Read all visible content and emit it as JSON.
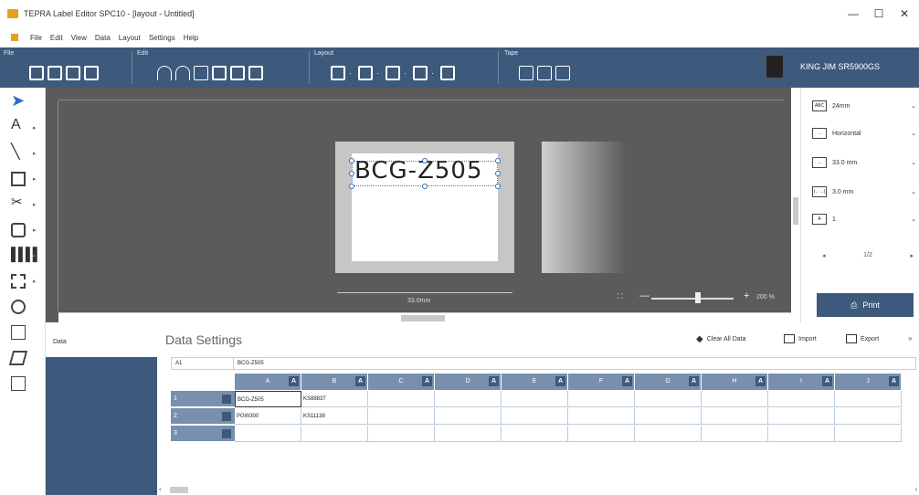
{
  "window": {
    "title": "TEPRA Label Editor SPC10 - [layout - Untitled]",
    "minimize": "—",
    "maximize": "☐",
    "close": "✕"
  },
  "menu": [
    "File",
    "Edit",
    "View",
    "Data",
    "Layout",
    "Settings",
    "Help"
  ],
  "ribbon": {
    "groups": [
      {
        "label": "File",
        "icons": [
          "new-icon",
          "open-icon",
          "save-icon",
          "book-icon"
        ]
      },
      {
        "label": "Edit",
        "icons": [
          "undo-icon",
          "redo-icon",
          "cut-icon",
          "copy-icon",
          "paste-icon",
          "delete-icon"
        ]
      },
      {
        "label": "Layout",
        "icons": [
          "align-icon",
          "distribute-icon",
          "rotate-icon",
          "group-icon",
          "arrange-icon"
        ]
      },
      {
        "label": "Tape",
        "icons": [
          "tape-cut-icon",
          "tape-margin-icon",
          "tape-feed-icon"
        ]
      }
    ],
    "printer_name": "KING JIM SR5900GS"
  },
  "tools": [
    "select-arrow-icon",
    "text-icon",
    "line-icon",
    "image-icon",
    "clipart-icon",
    "shape-icon",
    "barcode-icon",
    "qrcode-icon",
    "datetime-icon",
    "table-icon",
    "layout-icon",
    "import-icon"
  ],
  "canvas": {
    "label_text": "BCG-Z505",
    "dimension": "33.0mm",
    "zoom": "200 %",
    "colors": {
      "canvas_bg": "#5b5b5b",
      "accent": "#3d5a7c"
    }
  },
  "properties": [
    {
      "icon": "ABC",
      "name": "tape-width",
      "value": "24mm"
    },
    {
      "icon": "→",
      "name": "orientation",
      "value": "Horizontal"
    },
    {
      "icon": "↔",
      "name": "length",
      "value": "33.0 mm"
    },
    {
      "icon": "|←→|",
      "name": "margin",
      "value": "3.0 mm"
    },
    {
      "icon": "A",
      "name": "copies",
      "value": "1"
    }
  ],
  "page_nav": {
    "prev": "◂",
    "current": "1/2",
    "next": "▸"
  },
  "print_label": "Print",
  "data_panel": {
    "sidebar_label": "Data",
    "title": "Data Settings",
    "clear_all": "Clear All Data",
    "import": "Import",
    "export": "Export",
    "cell_ref": "A1",
    "cell_value": "BCG-Z505",
    "columns": [
      "A",
      "B",
      "C",
      "D",
      "E",
      "F",
      "G",
      "H",
      "I",
      "J"
    ],
    "badge": "A",
    "rows": [
      {
        "num": "1",
        "cells": [
          "BCG-Z505",
          "KS88837"
        ]
      },
      {
        "num": "2",
        "cells": [
          "PGW300",
          "KS11138"
        ]
      },
      {
        "num": "3",
        "cells": [
          "",
          ""
        ]
      }
    ]
  }
}
